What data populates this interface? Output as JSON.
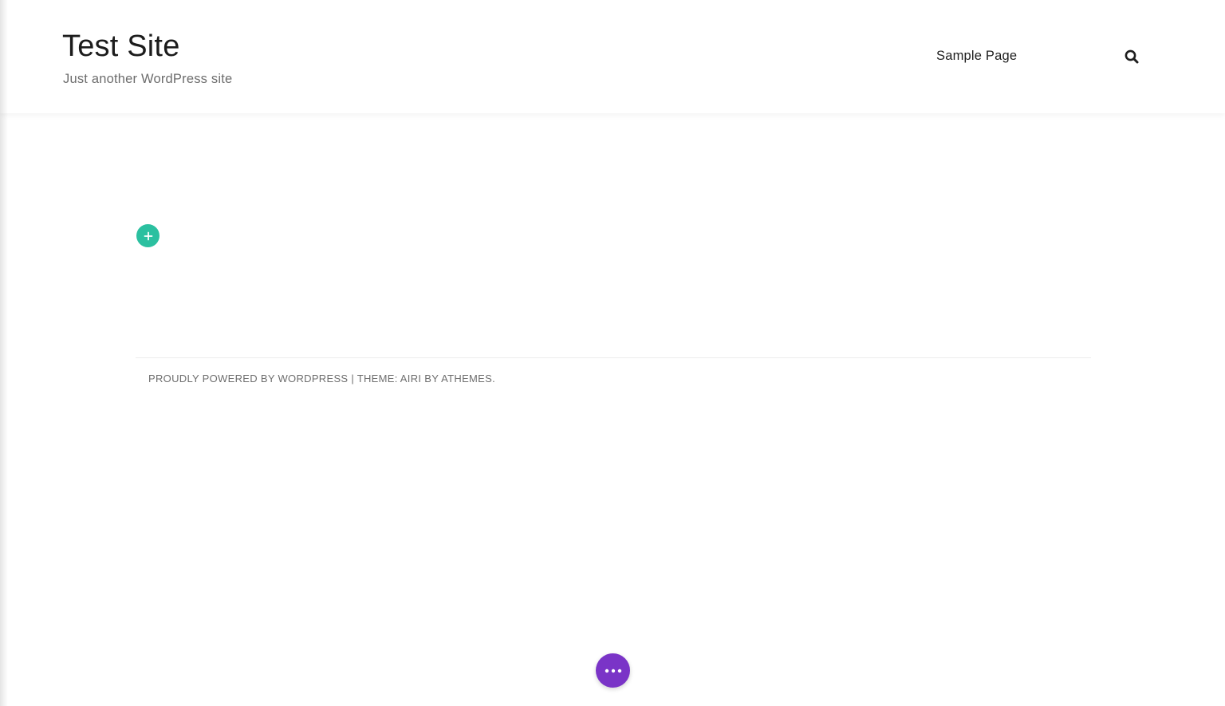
{
  "header": {
    "site_title": "Test Site",
    "site_description": "Just another WordPress site",
    "nav": {
      "items": [
        {
          "label": "Sample Page"
        }
      ]
    }
  },
  "icons": {
    "search": "search-icon",
    "add": "plus-icon",
    "more": "ellipsis-icon"
  },
  "footer": {
    "powered_by": "PROUDLY POWERED BY WORDPRESS",
    "separator": "|",
    "theme_label": "THEME: AIRI",
    "by_label": "BY",
    "theme_author": "ATHEMES",
    "end_punct": "."
  },
  "colors": {
    "add_button": "#2bc0a0",
    "more_button": "#7a34c7"
  }
}
